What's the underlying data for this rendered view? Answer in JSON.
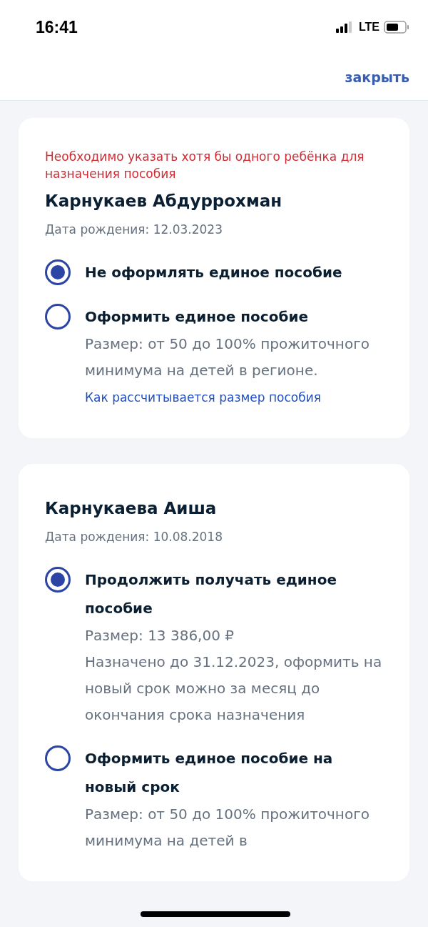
{
  "status_bar": {
    "time": "16:41",
    "network": "LTE"
  },
  "header": {
    "close": "закрыть"
  },
  "children": [
    {
      "error": "Необходимо указать хотя бы одного ребёнка для назначения пособия",
      "name": "Карнукаев Абдуррохман",
      "birth": "Дата рождения: 12.03.2023",
      "options": [
        {
          "title": "Не оформлять единое пособие",
          "selected": true
        },
        {
          "title": "Оформить единое пособие",
          "selected": false,
          "description": "Размер: от 50 до 100% прожиточного минимума на детей в регионе.",
          "link": "Как рассчитывается размер пособия"
        }
      ]
    },
    {
      "name": "Карнукаева Аиша",
      "birth": "Дата рождения: 10.08.2018",
      "options": [
        {
          "title": "Продолжить получать единое пособие",
          "selected": true,
          "details": [
            "Размер: 13 386,00 ₽",
            "Назначено до 31.12.2023, оформить на новый срок можно за месяц до окончания срока назначения"
          ]
        },
        {
          "title": "Оформить единое пособие на новый срок",
          "selected": false,
          "description": "Размер: от 50 до 100% прожиточного минимума на детей в"
        }
      ]
    }
  ]
}
